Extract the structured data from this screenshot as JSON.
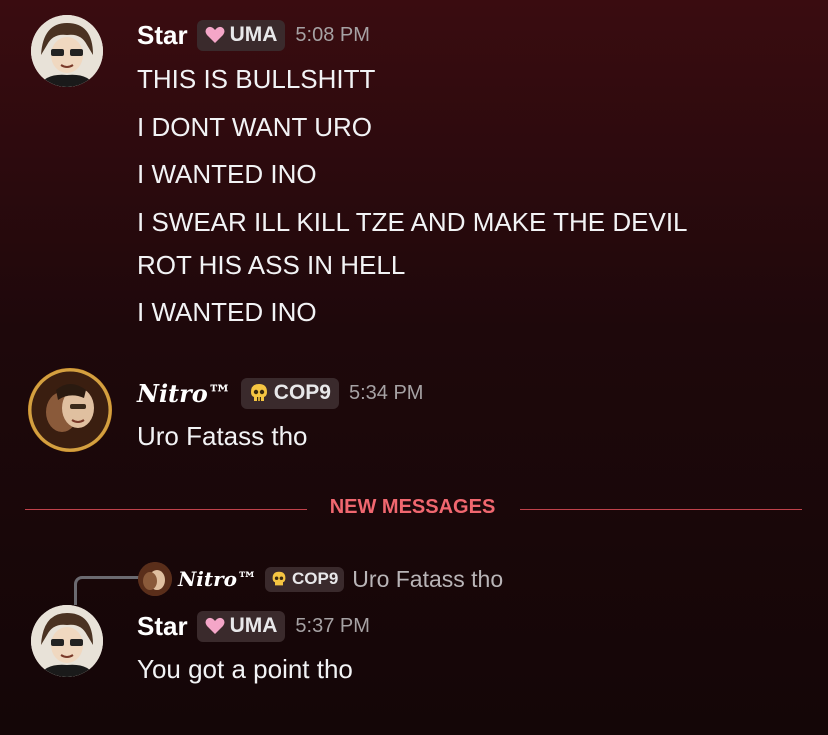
{
  "messages": [
    {
      "username": "Star",
      "tag": {
        "icon": "pink-heart-icon",
        "label": "UMA"
      },
      "time": "5:08 PM",
      "lines": [
        "THIS IS BULLSHITT",
        "I DONT WANT URO",
        "I WANTED INO",
        "I SWEAR ILL KILL TZE AND MAKE THE DEVIL",
        "ROT HIS ASS IN HELL",
        "I WANTED INO"
      ]
    },
    {
      "username": "Nitro™",
      "tag": {
        "icon": "yellow-skull-icon",
        "label": "COP9"
      },
      "time": "5:34 PM",
      "lines": [
        "Uro Fatass tho"
      ]
    },
    {
      "reply": {
        "username": "Nitro™",
        "tag_label": "COP9",
        "text": "Uro Fatass tho"
      },
      "username": "Star",
      "tag": {
        "icon": "pink-heart-icon",
        "label": "UMA"
      },
      "time": "5:37 PM",
      "lines": [
        "You got a point tho"
      ]
    }
  ],
  "divider": {
    "label": "NEW MESSAGES"
  },
  "colors": {
    "accent": "#f0676f",
    "divider": "#c0424b",
    "tag_bg": "#3a2a2c",
    "timestamp": "#a6a2a4"
  }
}
